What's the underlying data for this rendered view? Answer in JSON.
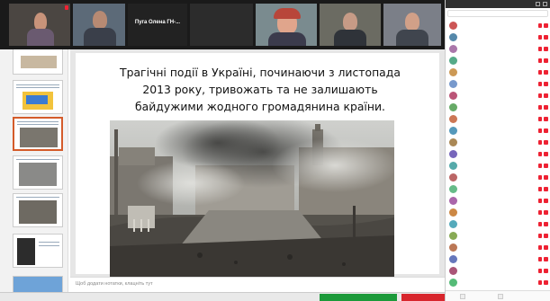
{
  "video": {
    "tiles": [
      {
        "name": "",
        "kind": "face"
      },
      {
        "name": "",
        "kind": "face"
      },
      {
        "name": "",
        "kind": "text",
        "big": "Пуга Олена ГН-..."
      },
      {
        "name": "",
        "kind": "face"
      },
      {
        "name": "",
        "kind": "face"
      },
      {
        "name": "",
        "kind": "face"
      }
    ]
  },
  "slide": {
    "text": "Трагічні події в Україні, починаючи з листопада 2013 року, тривожать та не залишають байдужими жодного громадянина країни."
  },
  "notes": {
    "placeholder": "Щоб додати нотатки, клацніть тут"
  },
  "participants": {
    "title": "",
    "rows": [
      {
        "name": "",
        "color": "#c55"
      },
      {
        "name": "",
        "color": "#58a"
      },
      {
        "name": "",
        "color": "#a7a"
      },
      {
        "name": "",
        "color": "#5a8"
      },
      {
        "name": "",
        "color": "#c95"
      },
      {
        "name": "",
        "color": "#79c"
      },
      {
        "name": "",
        "color": "#b57"
      },
      {
        "name": "",
        "color": "#6a6"
      },
      {
        "name": "",
        "color": "#c75"
      },
      {
        "name": "",
        "color": "#59b"
      },
      {
        "name": "",
        "color": "#a85"
      },
      {
        "name": "",
        "color": "#76b"
      },
      {
        "name": "",
        "color": "#5aa"
      },
      {
        "name": "",
        "color": "#b66"
      },
      {
        "name": "",
        "color": "#6b8"
      },
      {
        "name": "",
        "color": "#a6a"
      },
      {
        "name": "",
        "color": "#c84"
      },
      {
        "name": "",
        "color": "#5ab"
      },
      {
        "name": "",
        "color": "#8a5"
      },
      {
        "name": "",
        "color": "#b75"
      },
      {
        "name": "",
        "color": "#67b"
      },
      {
        "name": "",
        "color": "#a57"
      },
      {
        "name": "",
        "color": "#5b7"
      }
    ]
  },
  "colors": {
    "share_green": "#1c9a3a",
    "stop_red": "#d8262d",
    "selected_thumb": "#d45b2a"
  }
}
